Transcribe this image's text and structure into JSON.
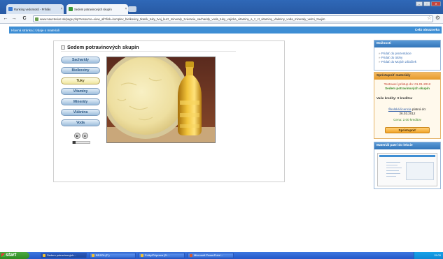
{
  "browser": {
    "tabs": [
      {
        "label": "Ranking vedomostí - Prihlás",
        "close": "×",
        "favicon_color": "#3a7bd5"
      },
      {
        "label": "Sedem potravinových skupín",
        "close": "×",
        "favicon_color": "#3a9a3a"
      }
    ],
    "window_controls": [
      "–",
      "▫",
      "✕"
    ],
    "nav": {
      "back": "←",
      "forward": "→",
      "reload": "C"
    },
    "url": "www.naucteviac.sk/page.php?resource=view_all?link=komplex_bielkoviny_tkanik_tuky_tvoj_kurz_mineraly_zvieracie_sacharidy_voda_tuky_vajicka_vitaminy_a_z_ct_vitaminy_vlakniny_voda_mineraly_velmi_zaujim",
    "star": "☆",
    "wrench": "⚙"
  },
  "site": {
    "breadcrumb_home": "Hlavná stránka",
    "breadcrumb_sep": "|",
    "breadcrumb_item": "Údaje o materiáli",
    "fullscreen": "Celá obrazovka"
  },
  "lesson": {
    "title": "Sedem potravinových skupín",
    "categories": [
      "Sacharidy",
      "Bielkoviny",
      "Tuky",
      "Vitamíny",
      "Minerály",
      "Vláknina",
      "Voda"
    ],
    "active_category": "Tuky"
  },
  "sidebar": {
    "possibilities": {
      "header": "Možnosti",
      "items": [
        "Pridať do prezentácie",
        "Pridať do úlohy",
        "Pridať do Mojich záložiek"
      ]
    },
    "buy": {
      "header": "Sprístupniť materiály",
      "test_access": "Testovací prístup do: 01.01.2012",
      "material": "Sedem potravinových skupín",
      "credits": "Vaše kredity: 0 kreditov",
      "license_link": "Školská licencia",
      "license_rest": "platná do:",
      "license_date": "26.03.2012",
      "price": "Cena: 2.00 kreditov",
      "button": "Sprístupniť"
    },
    "belongs": {
      "header": "Materiál patrí do lekcie"
    }
  },
  "taskbar": {
    "start": "start",
    "tasks": [
      {
        "label": "Sedem potravinových...",
        "color": "#f0c030"
      },
      {
        "label": "BEATA (F:)",
        "color": "#f0c030"
      },
      {
        "label": "Fotky/Príprava (D:...",
        "color": "#f0c030"
      },
      {
        "label": "Microsoft PowerPoint ...",
        "color": "#d85a30"
      }
    ],
    "tray_time": "15:05"
  }
}
